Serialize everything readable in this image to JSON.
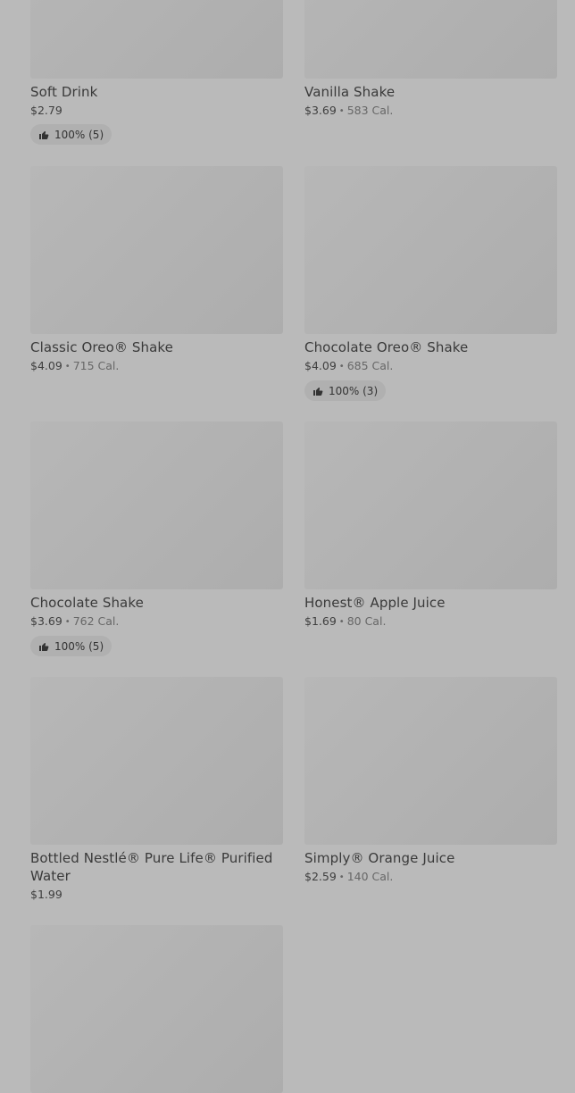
{
  "items": [
    {
      "name": "Soft Drink",
      "price": "$2.79",
      "calories": "",
      "rating": "100% (5)"
    },
    {
      "name": "Vanilla Shake",
      "price": "$3.69",
      "calories": "583 Cal.",
      "rating": ""
    },
    {
      "name": "Classic Oreo® Shake",
      "price": "$4.09",
      "calories": "715 Cal.",
      "rating": ""
    },
    {
      "name": "Chocolate Oreo® Shake",
      "price": "$4.09",
      "calories": "685 Cal.",
      "rating": "100% (3)"
    },
    {
      "name": "Chocolate Shake",
      "price": "$3.69",
      "calories": "762 Cal.",
      "rating": "100% (5)"
    },
    {
      "name": "Honest® Apple Juice",
      "price": "$1.69",
      "calories": "80 Cal.",
      "rating": ""
    },
    {
      "name": "Bottled Nestlé® Pure Life® Purified Water",
      "price": "$1.99",
      "calories": "",
      "rating": ""
    },
    {
      "name": "Simply® Orange Juice",
      "price": "$2.59",
      "calories": "140 Cal.",
      "rating": ""
    },
    {
      "name": "",
      "price": "",
      "calories": "",
      "rating": ""
    }
  ]
}
